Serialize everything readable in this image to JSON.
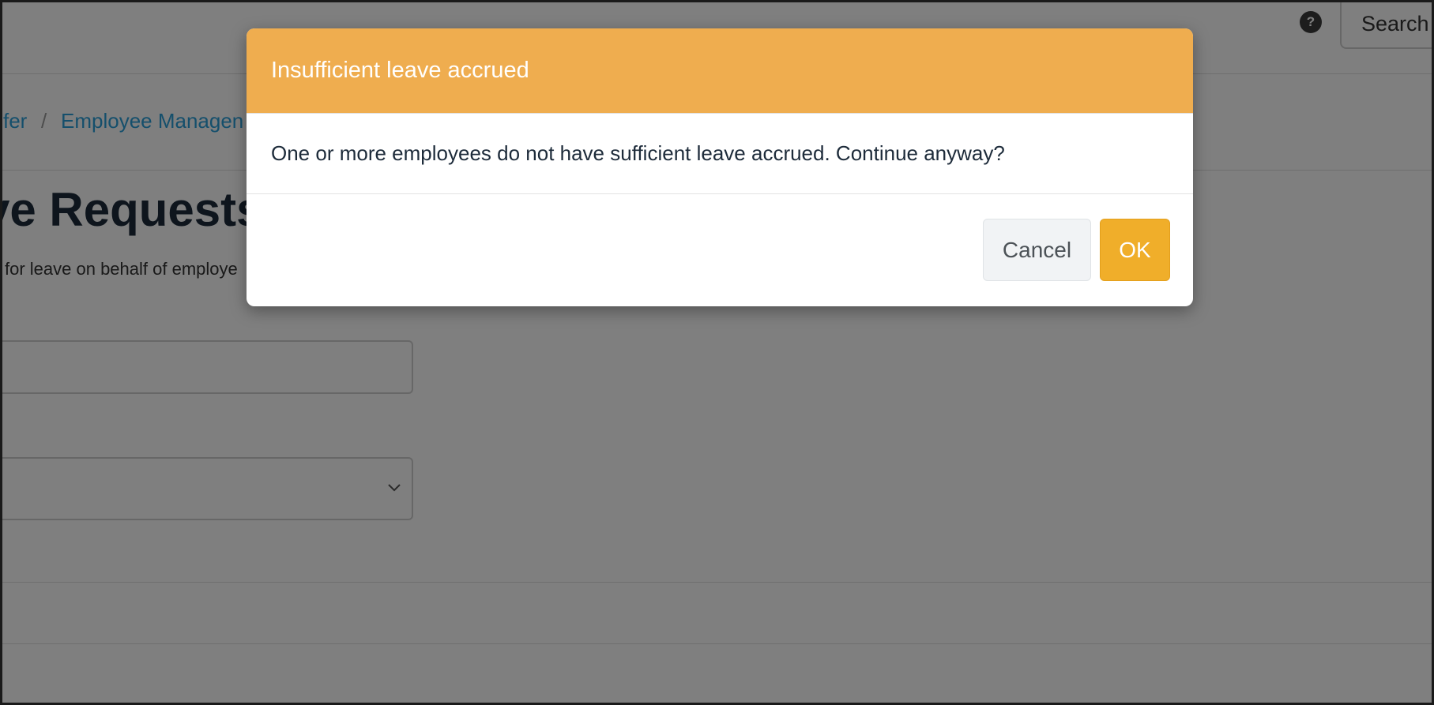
{
  "header": {
    "help_icon": "?",
    "search_label": "Search"
  },
  "breadcrumb": {
    "items": [
      "fer",
      "Employee Managen"
    ],
    "separator": "/"
  },
  "page": {
    "title": "ve Requests",
    "subtitle": "for leave on behalf of employe"
  },
  "modal": {
    "title": "Insufficient leave accrued",
    "message": "One or more employees do not have sufficient leave accrued. Continue anyway?",
    "cancel_label": "Cancel",
    "ok_label": "OK"
  },
  "colors": {
    "modal_header": "#efad4f",
    "ok_button": "#f0ae2a",
    "link": "#2a9fd8"
  },
  "icons": {
    "help": "question-circle-icon",
    "select_chevron": "chevron-down-icon"
  }
}
